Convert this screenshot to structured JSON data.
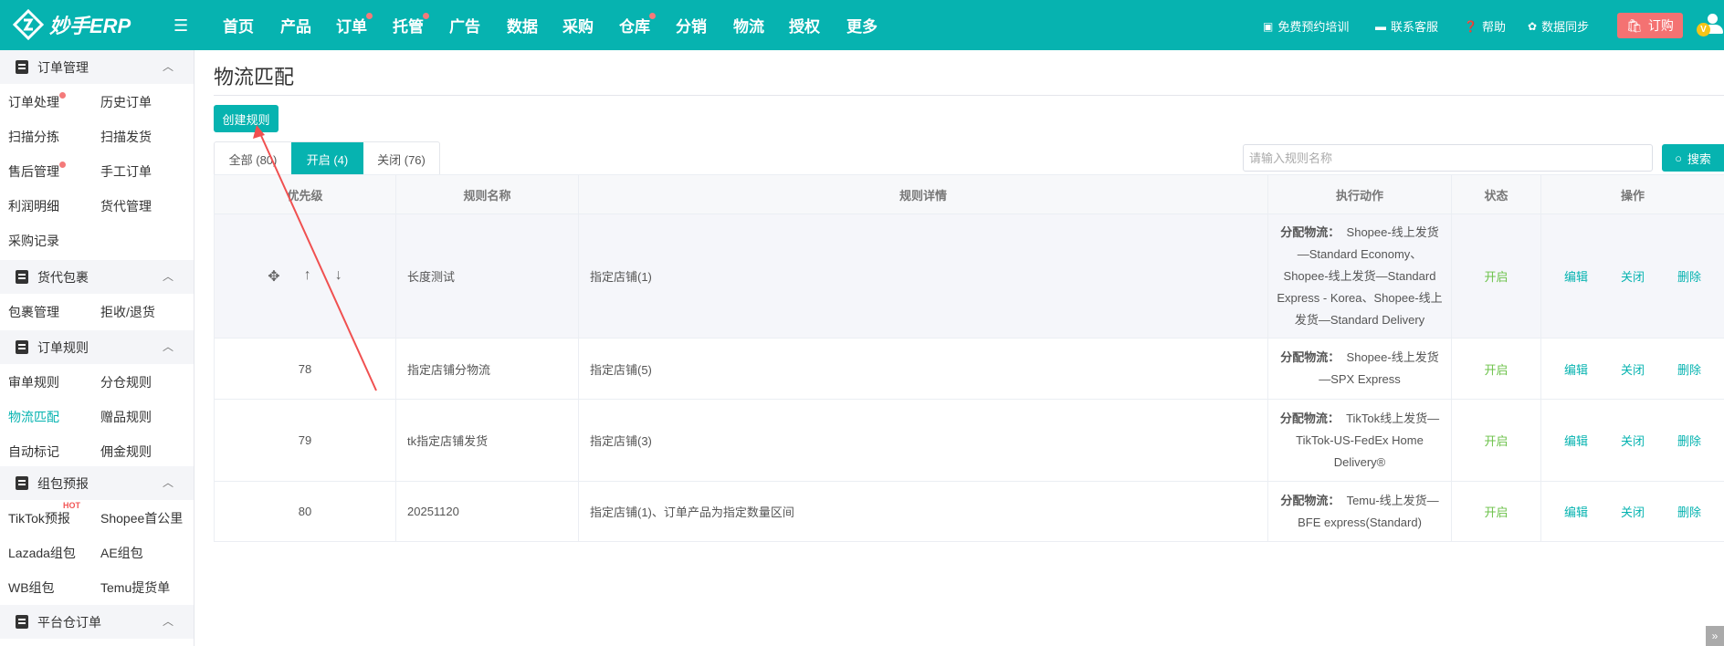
{
  "header": {
    "logo": "妙手ERP",
    "nav": [
      {
        "label": "首页",
        "dot": false
      },
      {
        "label": "产品",
        "dot": false
      },
      {
        "label": "订单",
        "dot": true
      },
      {
        "label": "托管",
        "dot": true
      },
      {
        "label": "广告",
        "dot": false
      },
      {
        "label": "数据",
        "dot": false
      },
      {
        "label": "采购",
        "dot": false
      },
      {
        "label": "仓库",
        "dot": true
      },
      {
        "label": "分销",
        "dot": false
      },
      {
        "label": "物流",
        "dot": false
      },
      {
        "label": "授权",
        "dot": false
      },
      {
        "label": "更多",
        "dot": false
      }
    ],
    "right": {
      "training": "免费预约培训",
      "service": "联系客服",
      "help": "帮助",
      "sync": "数据同步",
      "buy": "订购",
      "avatar_badge": "V"
    },
    "brand_color": "#06b3b0",
    "buy_color": "#f47272"
  },
  "sidebar": {
    "sections": [
      {
        "title": "订单管理",
        "items": [
          "订单处理",
          "历史订单",
          "扫描分拣",
          "扫描发货",
          "售后管理",
          "手工订单",
          "利润明细",
          "货代管理",
          "采购记录"
        ]
      },
      {
        "title": "货代包裹",
        "items": [
          "包裹管理",
          "拒收/退货"
        ]
      },
      {
        "title": "订单规则",
        "items": [
          "审单规则",
          "分仓规则",
          "物流匹配",
          "赠品规则",
          "自动标记",
          "佣金规则"
        ]
      },
      {
        "title": "组包预报",
        "items": [
          "TikTok预报",
          "Shopee首公里",
          "Lazada组包",
          "AE组包",
          "WB组包",
          "Temu提货单"
        ],
        "hot": "HOT"
      },
      {
        "title": "平台仓订单",
        "items": []
      }
    ]
  },
  "main": {
    "title": "物流匹配",
    "create_button": "创建规则",
    "tabs": [
      "全部 (80)",
      "开启 (4)",
      "关闭 (76)"
    ],
    "search": {
      "placeholder": "请输入规则名称",
      "button": "搜索"
    },
    "table": {
      "headers": [
        "优先级",
        "规则名称",
        "规则详情",
        "执行动作",
        "状态",
        "操作"
      ],
      "action_prefix": "分配物流：",
      "ops": [
        "编辑",
        "关闭",
        "删除"
      ],
      "rows": [
        {
          "priority": "",
          "name": "长度测试",
          "detail": "指定店铺(1)",
          "action": "Shopee-线上发货—Standard Economy、Shopee-线上发货—Standard Express - Korea、Shopee-线上发货—Standard Delivery",
          "status": "开启"
        },
        {
          "priority": "78",
          "name": "指定店铺分物流",
          "detail": "指定店铺(5)",
          "action": "Shopee-线上发货—SPX Express",
          "status": "开启"
        },
        {
          "priority": "79",
          "name": "tk指定店铺发货",
          "detail": "指定店铺(3)",
          "action": "TikTok线上发货—TikTok-US-FedEx Home Delivery®",
          "status": "开启"
        },
        {
          "priority": "80",
          "name": "20251120",
          "detail": "指定店铺(1)、订单产品为指定数量区间",
          "action": "Temu-线上发货—BFE express(Standard)",
          "status": "开启"
        }
      ]
    }
  }
}
